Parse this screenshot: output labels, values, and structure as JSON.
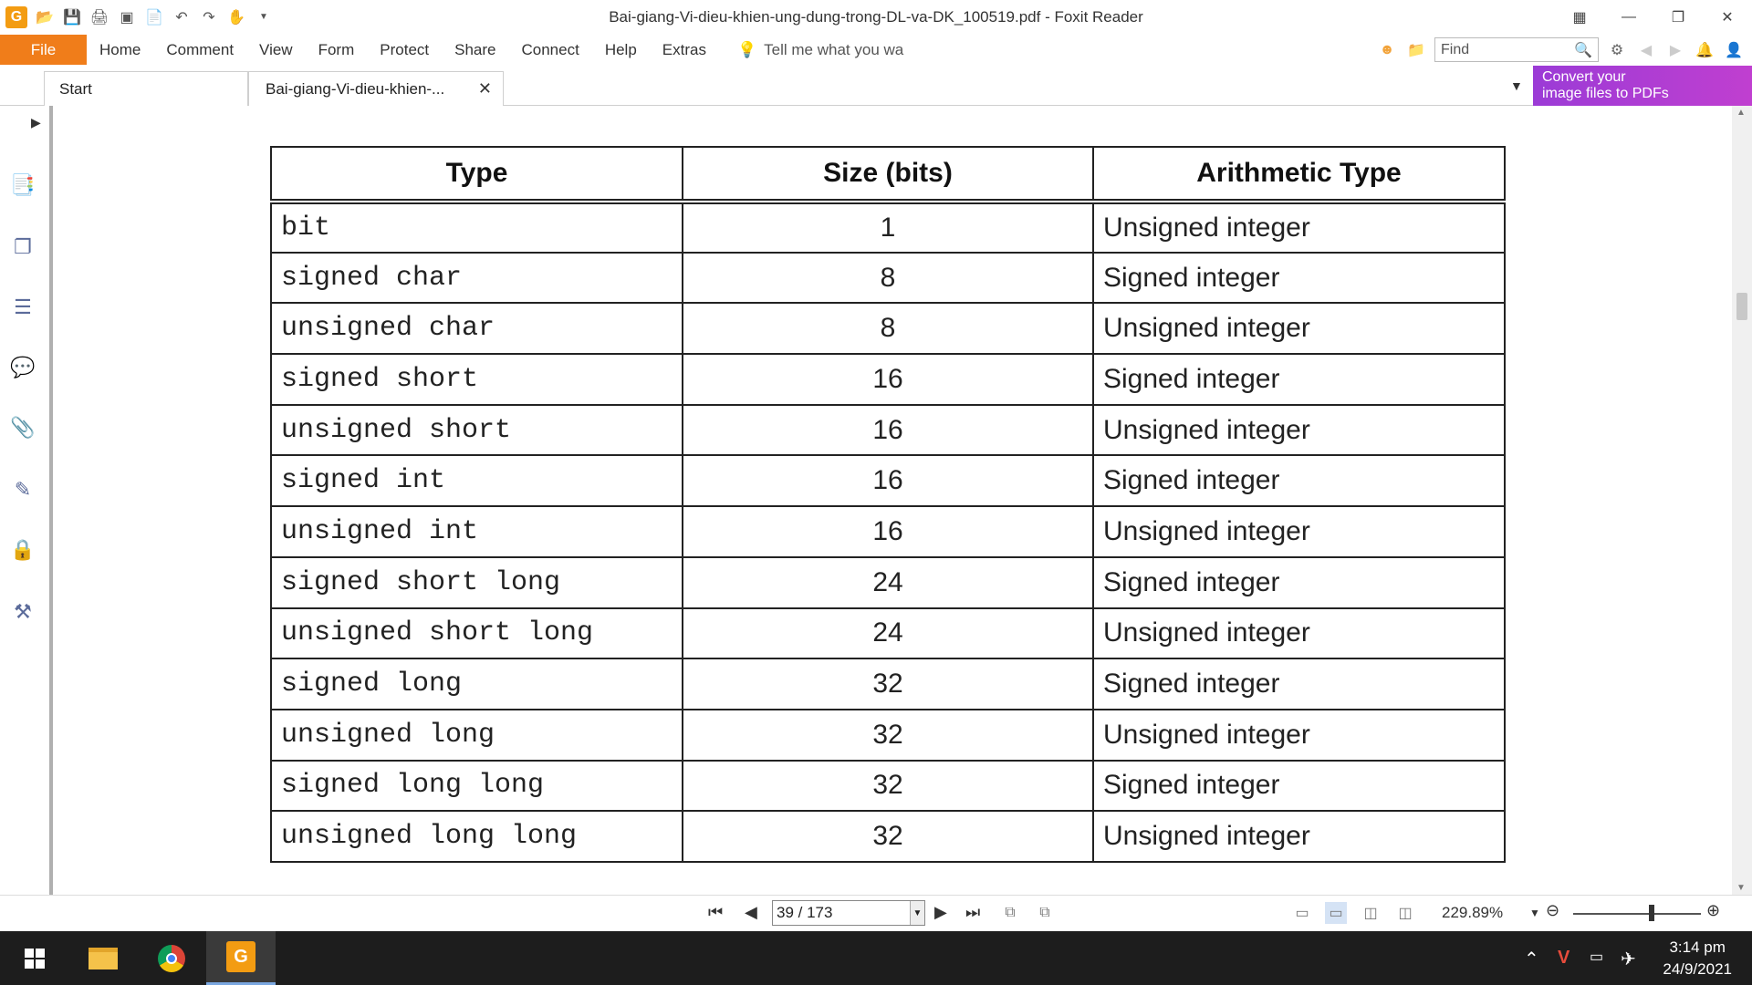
{
  "window": {
    "title": "Bai-giang-Vi-dieu-khien-ung-dung-trong-DL-va-DK_100519.pdf - Foxit Reader"
  },
  "menu": {
    "file": "File",
    "items": [
      "Home",
      "Comment",
      "View",
      "Form",
      "Protect",
      "Share",
      "Connect",
      "Help",
      "Extras"
    ],
    "tell_me": "Tell me what you wa",
    "find_placeholder": "Find"
  },
  "tabs": {
    "start": "Start",
    "doc": "Bai-giang-Vi-dieu-khien-..."
  },
  "banner": {
    "line1": "Convert your",
    "line2": "image files to PDFs"
  },
  "table": {
    "headers": [
      "Type",
      "Size (bits)",
      "Arithmetic Type"
    ],
    "rows": [
      [
        "bit",
        "1",
        "Unsigned integer"
      ],
      [
        "signed char",
        "8",
        "Signed integer"
      ],
      [
        "unsigned char",
        "8",
        "Unsigned integer"
      ],
      [
        "signed short",
        "16",
        "Signed integer"
      ],
      [
        "unsigned short",
        "16",
        "Unsigned integer"
      ],
      [
        "signed int",
        "16",
        "Signed integer"
      ],
      [
        "unsigned int",
        "16",
        "Unsigned integer"
      ],
      [
        "signed short long",
        "24",
        "Signed integer"
      ],
      [
        "unsigned short long",
        "24",
        "Unsigned integer"
      ],
      [
        "signed long",
        "32",
        "Signed integer"
      ],
      [
        "unsigned long",
        "32",
        "Unsigned integer"
      ],
      [
        "signed long long",
        "32",
        "Signed integer"
      ],
      [
        "unsigned long long",
        "32",
        "Unsigned integer"
      ]
    ]
  },
  "status": {
    "page": "39 / 173",
    "zoom": "229.89%"
  },
  "taskbar": {
    "time": "3:14 pm",
    "date": "24/9/2021"
  },
  "colors": {
    "file_button": "#f07d1a",
    "banner": "#b03ed4",
    "taskbar": "#1d1d1d"
  }
}
